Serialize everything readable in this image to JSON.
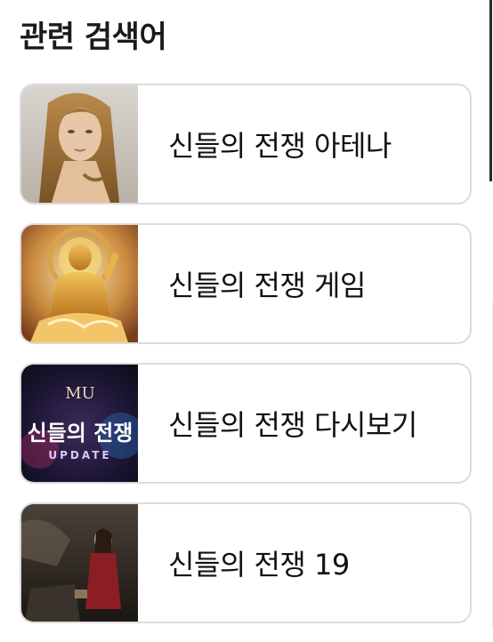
{
  "section": {
    "title": "관련 검색어"
  },
  "related_searches": [
    {
      "label": "신들의 전쟁 아테나"
    },
    {
      "label": "신들의 전쟁 게임"
    },
    {
      "label": "신들의 전쟁 다시보기",
      "thumb_caption_top": "MU",
      "thumb_caption_main": "신들의 전쟁",
      "thumb_caption_bottom": "UPDATE"
    },
    {
      "label": "신들의 전쟁 19"
    }
  ]
}
